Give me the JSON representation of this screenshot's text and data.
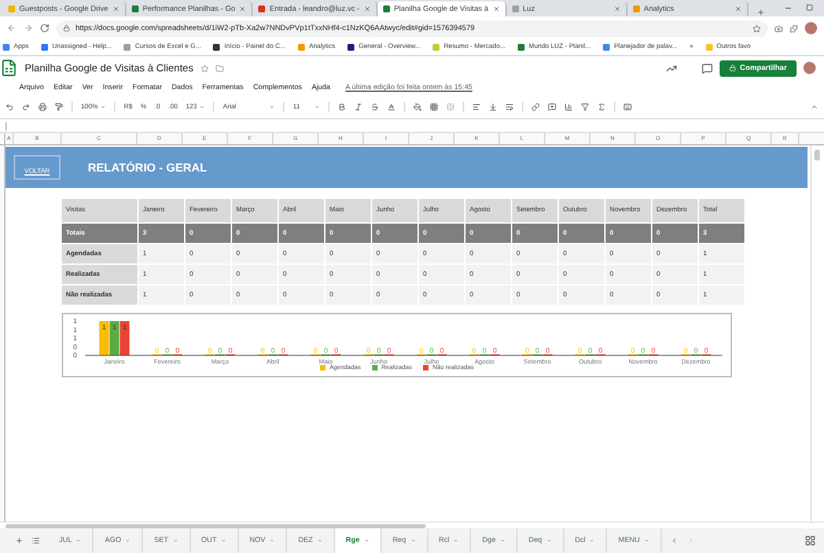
{
  "browser": {
    "tabs": [
      {
        "title": "Guestposts - Google Drive",
        "selected": false
      },
      {
        "title": "Performance Planilhas - Go",
        "selected": false
      },
      {
        "title": "Entrada - leandro@luz.vc - ",
        "selected": false
      },
      {
        "title": "Planilha Google de Visitas à",
        "selected": true
      },
      {
        "title": "Luz",
        "selected": false
      },
      {
        "title": "Analytics",
        "selected": false
      }
    ],
    "address": "https://docs.google.com/spreadsheets/d/1iW2-pTb-Xa2w7NNDvPVp1tTxxNHf4-c1NzKQ6AAtwyc/edit#gid=1576394579",
    "bookmarks": [
      "Apps",
      "Unassigned - Help...",
      "Cursos de Excel e G...",
      "Início - Painel do C...",
      "Analytics",
      "General - Overview...",
      "Resumo - Mercado...",
      "Mundo LUZ - Planil...",
      "Planejador de palav...",
      "»",
      "Outros favo"
    ]
  },
  "document": {
    "title": "Planilha Google de Visitas à Clientes",
    "share_button": "Compartilhar",
    "menu": [
      "Arquivo",
      "Editar",
      "Ver",
      "Inserir",
      "Formatar",
      "Dados",
      "Ferramentas",
      "Complementos",
      "Ajuda"
    ],
    "last_edit": "A última edição foi feita ontem às 15:45"
  },
  "toolbar": {
    "zoom": "100%",
    "currency": "R$",
    "percent": "%",
    "decrease_decimals": ".0",
    "increase_decimals": ".00",
    "more_formats": "123",
    "font": "Arial",
    "font_size": "11"
  },
  "sheet": {
    "columns": [
      "A",
      "B",
      "C",
      "D",
      "E",
      "F",
      "G",
      "H",
      "I",
      "J",
      "K",
      "L",
      "M",
      "N",
      "O",
      "P",
      "Q",
      "R"
    ],
    "banner": {
      "button": "VOLTAR",
      "title": "RELATÓRIO - GERAL"
    },
    "table": {
      "columns": [
        "Visitas",
        "Janeiro",
        "Fevereiro",
        "Março",
        "Abril",
        "Maio",
        "Junho",
        "Julho",
        "Agosto",
        "Setembro",
        "Outubro",
        "Novembro",
        "Dezembro",
        "Total"
      ],
      "rows": [
        {
          "kind": "total",
          "cells": [
            "Totais",
            "3",
            "0",
            "0",
            "0",
            "0",
            "0",
            "0",
            "0",
            "0",
            "0",
            "0",
            "0",
            "3"
          ]
        },
        {
          "kind": "data",
          "cells": [
            "Agendadas",
            "1",
            "0",
            "0",
            "0",
            "0",
            "0",
            "0",
            "0",
            "0",
            "0",
            "0",
            "0",
            "1"
          ]
        },
        {
          "kind": "data",
          "cells": [
            "Realizadas",
            "1",
            "0",
            "0",
            "0",
            "0",
            "0",
            "0",
            "0",
            "0",
            "0",
            "0",
            "0",
            "1"
          ]
        },
        {
          "kind": "data",
          "cells": [
            "Não realizadas",
            "1",
            "0",
            "0",
            "0",
            "0",
            "0",
            "0",
            "0",
            "0",
            "0",
            "0",
            "0",
            "1"
          ]
        }
      ]
    },
    "chart": {
      "chart_data": {
        "type": "bar",
        "categories": [
          "Janeiro",
          "Fevereiro",
          "Março",
          "Abril",
          "Maio",
          "Junho",
          "Julho",
          "Agosto",
          "Setembro",
          "Outubro",
          "Novembro",
          "Dezembro"
        ],
        "series": [
          {
            "name": "Agendadas",
            "color": "#fbbc04",
            "values": [
              1,
              0,
              0,
              0,
              0,
              0,
              0,
              0,
              0,
              0,
              0,
              0
            ]
          },
          {
            "name": "Realizadas",
            "color": "#5aac44",
            "values": [
              1,
              0,
              0,
              0,
              0,
              0,
              0,
              0,
              0,
              0,
              0,
              0
            ]
          },
          {
            "name": "Não realizadas",
            "color": "#ea4335",
            "values": [
              1,
              0,
              0,
              0,
              0,
              0,
              0,
              0,
              0,
              0,
              0,
              0
            ]
          }
        ],
        "ylim": [
          0,
          1
        ],
        "yticks": [
          {
            "value": 1,
            "label": "1"
          },
          {
            "value": 0.75,
            "label": "1"
          },
          {
            "value": 0.5,
            "label": "1"
          },
          {
            "value": 0.25,
            "label": "0"
          },
          {
            "value": 0,
            "label": "0"
          }
        ],
        "data_labels": true,
        "legend": "bottom"
      }
    }
  },
  "sheet_tabs": [
    {
      "label": "JUL",
      "selected": false
    },
    {
      "label": "AGO",
      "selected": false
    },
    {
      "label": "SET",
      "selected": false
    },
    {
      "label": "OUT",
      "selected": false
    },
    {
      "label": "NOV",
      "selected": false
    },
    {
      "label": "DEZ",
      "selected": false
    },
    {
      "label": "Rge",
      "selected": true
    },
    {
      "label": "Req",
      "selected": false
    },
    {
      "label": "Rcl",
      "selected": false
    },
    {
      "label": "Dge",
      "selected": false
    },
    {
      "label": "Deq",
      "selected": false
    },
    {
      "label": "Dcl",
      "selected": false
    },
    {
      "label": "MENU",
      "selected": false
    }
  ]
}
